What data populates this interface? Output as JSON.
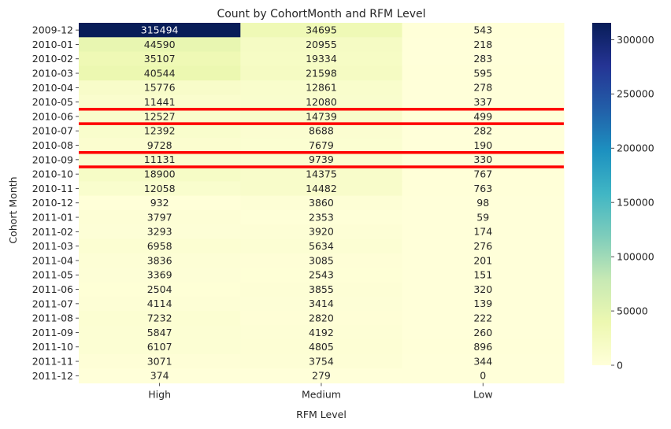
{
  "chart_data": {
    "type": "heatmap",
    "title": "Count by CohortMonth and RFM Level",
    "xlabel": "RFM Level",
    "ylabel": "Cohort Month",
    "columns": [
      "High",
      "Medium",
      "Low"
    ],
    "rows": [
      "2009-12",
      "2010-01",
      "2010-02",
      "2010-03",
      "2010-04",
      "2010-05",
      "2010-06",
      "2010-07",
      "2010-08",
      "2010-09",
      "2010-10",
      "2010-11",
      "2010-12",
      "2011-01",
      "2011-02",
      "2011-03",
      "2011-04",
      "2011-05",
      "2011-06",
      "2011-07",
      "2011-08",
      "2011-09",
      "2011-10",
      "2011-11",
      "2011-12"
    ],
    "values": [
      [
        315494,
        34695,
        543
      ],
      [
        44590,
        20955,
        218
      ],
      [
        35107,
        19334,
        283
      ],
      [
        40544,
        21598,
        595
      ],
      [
        15776,
        12861,
        278
      ],
      [
        11441,
        12080,
        337
      ],
      [
        12527,
        14739,
        499
      ],
      [
        12392,
        8688,
        282
      ],
      [
        9728,
        7679,
        190
      ],
      [
        11131,
        9739,
        330
      ],
      [
        18900,
        14375,
        767
      ],
      [
        12058,
        14482,
        763
      ],
      [
        932,
        3860,
        98
      ],
      [
        3797,
        2353,
        59
      ],
      [
        3293,
        3920,
        174
      ],
      [
        6958,
        5634,
        276
      ],
      [
        3836,
        3085,
        201
      ],
      [
        3369,
        2543,
        151
      ],
      [
        2504,
        3855,
        320
      ],
      [
        4114,
        3414,
        139
      ],
      [
        7232,
        2820,
        222
      ],
      [
        5847,
        4192,
        260
      ],
      [
        6107,
        4805,
        896
      ],
      [
        3071,
        3754,
        344
      ],
      [
        374,
        279,
        0
      ]
    ],
    "colormap": "YlGnBu",
    "colormap_stops": [
      "#ffffd9",
      "#edf8b1",
      "#c7e9b4",
      "#7fcdbb",
      "#41b6c4",
      "#1d91c0",
      "#225ea8",
      "#253494",
      "#081d58"
    ],
    "vmin": 0,
    "vmax": 315494,
    "colorbar_ticks": [
      "0",
      "50000",
      "100000",
      "150000",
      "200000",
      "250000",
      "300000"
    ],
    "colorbar_tick_values": [
      0,
      50000,
      100000,
      150000,
      200000,
      250000,
      300000
    ],
    "highlighted_rows": [
      "2010-06",
      "2010-09"
    ],
    "highlight_color": "#ff0000"
  }
}
